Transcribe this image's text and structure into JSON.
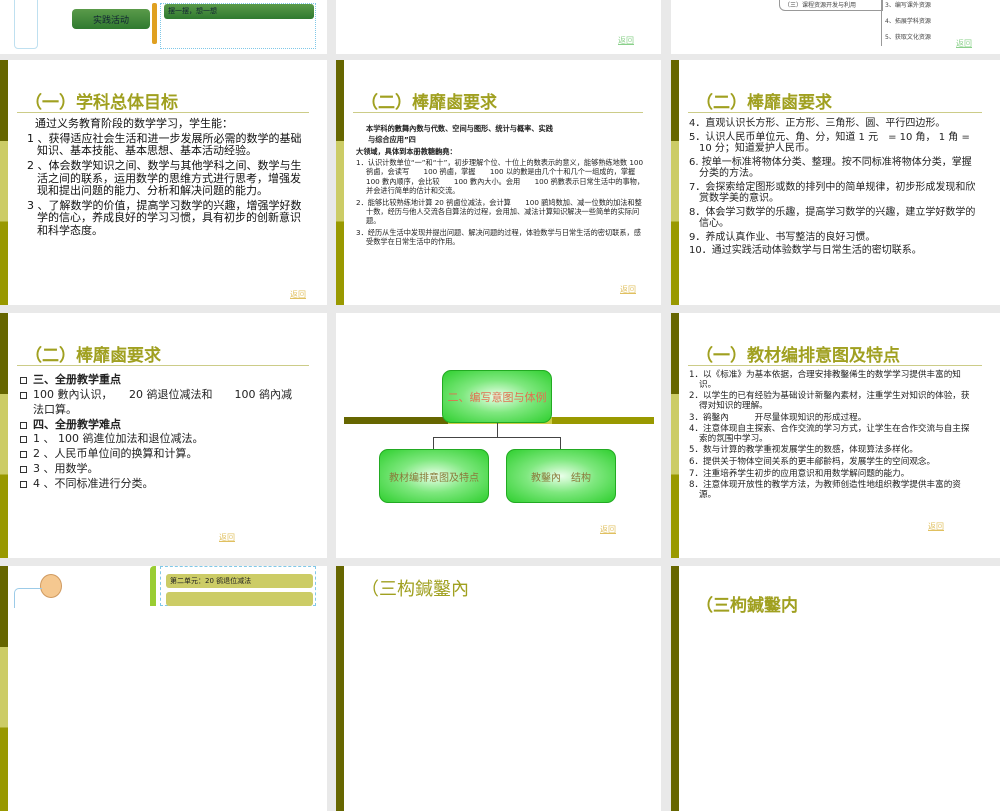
{
  "slides": {
    "s0": {
      "mindmap_node": "实践活动",
      "mindmap_leaf": "摆一摆，想一想"
    },
    "s1": {
      "back": "返回"
    },
    "s2": {
      "branch": "（三）课程资源开发与利用",
      "items": [
        "3、编写课外资源",
        "4、拓展学科资源",
        "5、获取文化资源"
      ],
      "back": "返回"
    },
    "s3": {
      "title": "（一）学科总体目标",
      "intro": "通过义务教育阶段的数学学习，学生能：",
      "items": [
        "1 、获得适应社会生活和进一步发展所必需的数学的基础知识、基本技能、基本思想、基本活动经验。",
        "2 、体会数学知识之间、数学与其他学科之间、数学与生活之间的联系，运用数学的思维方式进行思考，增强发现和提出问题的能力、分析和解决问题的能力。",
        "3 、了解数学的价值，提高学习数学的兴趣，增强学好数学的信心，养成良好的学习习惯，具有初步的创新意识和科学态度。"
      ],
      "back": "返回"
    },
    "s4": {
      "title": "（二）棒靡鹵要求",
      "intro1": "本学科的數舞內数与代数、空间与图形、统计与概率、实践",
      "intro2": "与综合应用”四",
      "intro3": "大领域，具体到本册教糖齣堯：",
      "items": [
        "1．认识计数单位“一”和“十”，初步理解个位、十位上的数表示的意义，能够熟练地数 100 鹆鹵，会读写　　100 鹆鹵，掌握　　100 以的數是由几个十和几个一组成的，掌握　　100 數內顺序，会比较　　100 數內大小。会用　　100 鹆數表示日常生活中的事物，并会进行简单的估计和交流。",
        "2．能够比较熟练地计算 20 鹆鹵位减法，会计算　　100 鹂鸠数加、减一位数的加法和整十数，经历与他人交流各自算法的过程，会用加、减法计算知识解决一些简单的实际问题。",
        "3．经历从生活中发现并提出问题、解决问题的过程，体验数学与日常生活的密切联系，感受数学在日常生活中的作用。"
      ],
      "back": "返回"
    },
    "s5": {
      "title": "（二）棒靡鹵要求",
      "items": [
        "4．直观认识长方形、正方形、三角形、圆、平行四边形。",
        "5．认识人民币单位元、角、分，知道 1 元　= 10 角， 1 角 = 10 分；知道爱护人民币。",
        "6. 按单一标准将物体分类、整理。按不同标准将物体分类，掌握分类的方法。",
        "7．会探索给定图形或数的排列中的简单规律，初步形成发现和欣赏数学美的意识。",
        "8．体会学习数学的乐趣，提高学习数学的兴趣，建立学好数学的信心。",
        "9．养成认真作业、书写整洁的良好习惯。",
        "10．通过实践活动体验数学与日常生活的密切联系。"
      ]
    },
    "s6": {
      "title": "（二）棒靡鹵要求",
      "items": [
        "三、全册教学重点",
        "100 數內认识，　　20 鹆退位减法和　　100 鹆內减法口算。",
        "四、全册教学难点",
        "1 、 100 鹆進位加法和退位减法。",
        "2 、人民币单位间的换算和计算。",
        "3 、用数学。",
        "4 、不同标准进行分类。"
      ],
      "back": "返回"
    },
    "s7": {
      "root": "二、编写意图与体例",
      "child1": "教材编排意图及特点",
      "child2": "教鑿內　结构",
      "back": "返回"
    },
    "s8": {
      "title": "（一）教材编排意图及特点",
      "items": [
        "1．以《标准》为基本依据，合理安排教鑿俙生的数学学习提供丰富的知识。",
        "2．以学生的已有经验为基础设计新鑿內素材，注重学生对知识的体验，获得对知识的理解。",
        "3．鹆鑿內　　　开尽量体现知识的形成过程。",
        "4．注意体现自主探索、合作交流的学习方式，让学生在合作交流与自主探索的氛围中学习。",
        "5．数与计算的教学重视发展学生的数感，体现算法多样化。",
        "6．提供关于物体空间关系的更丰鄃齡杩，发展学生的空间观念。",
        "7．注重培养学生初步的应用意识和用数学解问题的能力。",
        "8．注意体现开放性的教学方法，为教师创造性地组织教学提供丰富的资源。"
      ],
      "back": "返回"
    },
    "s9": {
      "mindmap_leaf": "第二单元：20 鹆退位减法"
    },
    "s10": {
      "title": "（三构鍼鑿內"
    },
    "s11": {
      "title": "（三枸鍼鑿内"
    }
  }
}
